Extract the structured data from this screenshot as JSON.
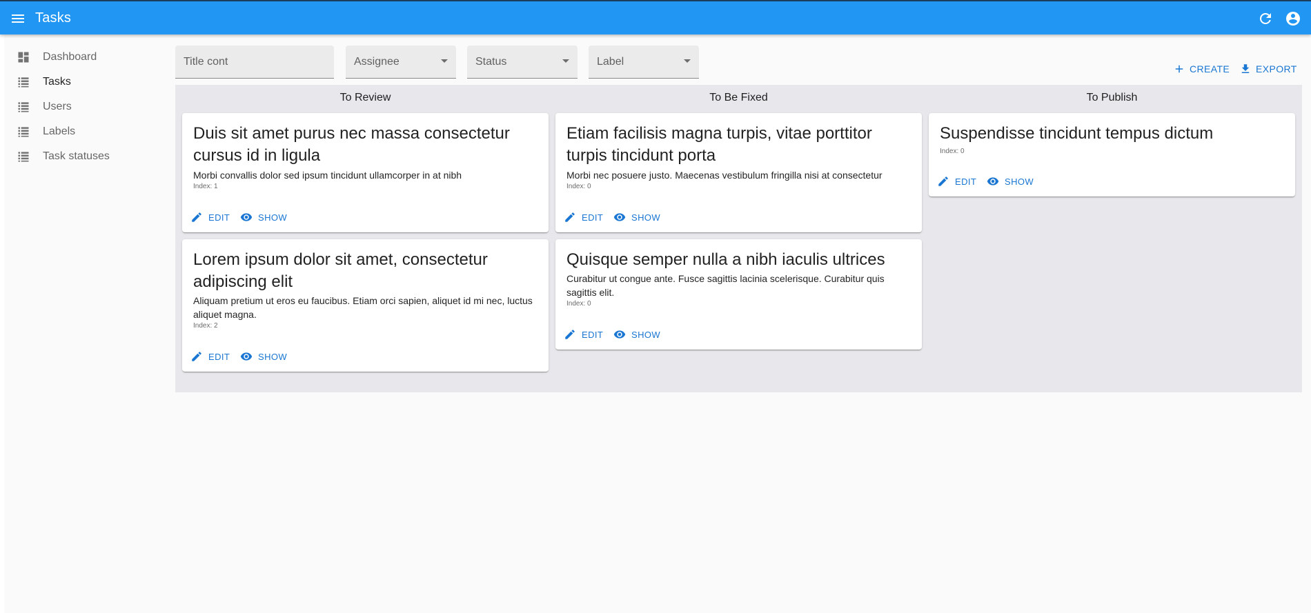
{
  "app_bar": {
    "title": "Tasks",
    "icons": {
      "menu": "menu-icon",
      "refresh": "refresh-icon",
      "account": "account-circle-icon"
    }
  },
  "sidebar": {
    "items": [
      {
        "label": "Dashboard",
        "icon": "dashboard-icon",
        "active": false
      },
      {
        "label": "Tasks",
        "icon": "list-icon",
        "active": true
      },
      {
        "label": "Users",
        "icon": "list-icon",
        "active": false
      },
      {
        "label": "Labels",
        "icon": "list-icon",
        "active": false
      },
      {
        "label": "Task statuses",
        "icon": "list-icon",
        "active": false
      }
    ]
  },
  "filters": {
    "title": {
      "label": "Title cont",
      "value": ""
    },
    "assignee": {
      "label": "Assignee",
      "value": ""
    },
    "status": {
      "label": "Status",
      "value": ""
    },
    "label": {
      "label": "Label",
      "value": ""
    }
  },
  "actions": {
    "create_label": "CREATE",
    "export_label": "EXPORT"
  },
  "board": {
    "columns": [
      {
        "title": "To Review",
        "cards": [
          {
            "title": "Duis sit amet purus nec massa consectetur cursus id in ligula",
            "description": "Morbi convallis dolor sed ipsum tincidunt ullamcorper in at nibh",
            "index": "Index: 1",
            "edit_label": "EDIT",
            "show_label": "SHOW"
          },
          {
            "title": "Lorem ipsum dolor sit amet, consectetur adipiscing elit",
            "description": "Aliquam pretium ut eros eu faucibus. Etiam orci sapien, aliquet id mi nec, luctus aliquet magna.",
            "index": "Index: 2",
            "edit_label": "EDIT",
            "show_label": "SHOW"
          }
        ]
      },
      {
        "title": "To Be Fixed",
        "cards": [
          {
            "title": "Etiam facilisis magna turpis, vitae porttitor turpis tincidunt porta",
            "description": "Morbi nec posuere justo. Maecenas vestibulum fringilla nisi at consectetur",
            "index": "Index: 0",
            "edit_label": "EDIT",
            "show_label": "SHOW"
          },
          {
            "title": "Quisque semper nulla a nibh iaculis ultrices",
            "description": "Curabitur ut congue ante. Fusce sagittis lacinia scelerisque. Curabitur quis sagittis elit.",
            "index": "Index: 0",
            "edit_label": "EDIT",
            "show_label": "SHOW"
          }
        ]
      },
      {
        "title": "To Publish",
        "cards": [
          {
            "title": "Suspendisse tincidunt tempus dictum",
            "description": "",
            "index": "Index: 0",
            "edit_label": "EDIT",
            "show_label": "SHOW"
          }
        ]
      }
    ]
  },
  "colors": {
    "app_bar": "#2196f3",
    "primary_text_button": "#1976d2",
    "board_background": "#e8e8ec",
    "page_background": "#fafafa"
  }
}
